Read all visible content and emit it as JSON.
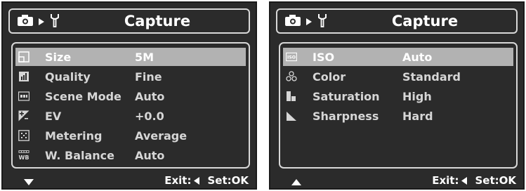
{
  "left": {
    "title": "Capture",
    "items": [
      {
        "label": "Size",
        "value": "5M",
        "icon": "size-icon"
      },
      {
        "label": "Quality",
        "value": "Fine",
        "icon": "quality-icon"
      },
      {
        "label": "Scene Mode",
        "value": "Auto",
        "icon": "scene-mode-icon"
      },
      {
        "label": "EV",
        "value": "+0.0",
        "icon": "ev-icon"
      },
      {
        "label": "Metering",
        "value": "Average",
        "icon": "metering-icon"
      },
      {
        "label": "W. Balance",
        "value": "Auto",
        "icon": "white-balance-icon",
        "icon_text": "WB"
      }
    ],
    "exit_label": "Exit:",
    "set_label": "Set:OK"
  },
  "right": {
    "title": "Capture",
    "items": [
      {
        "label": "ISO",
        "value": "Auto",
        "icon": "iso-icon",
        "icon_text": "ISO"
      },
      {
        "label": "Color",
        "value": "Standard",
        "icon": "color-icon"
      },
      {
        "label": "Saturation",
        "value": "High",
        "icon": "saturation-icon"
      },
      {
        "label": "Sharpness",
        "value": "Hard",
        "icon": "sharpness-icon"
      }
    ],
    "exit_label": "Exit:",
    "set_label": "Set:OK"
  }
}
